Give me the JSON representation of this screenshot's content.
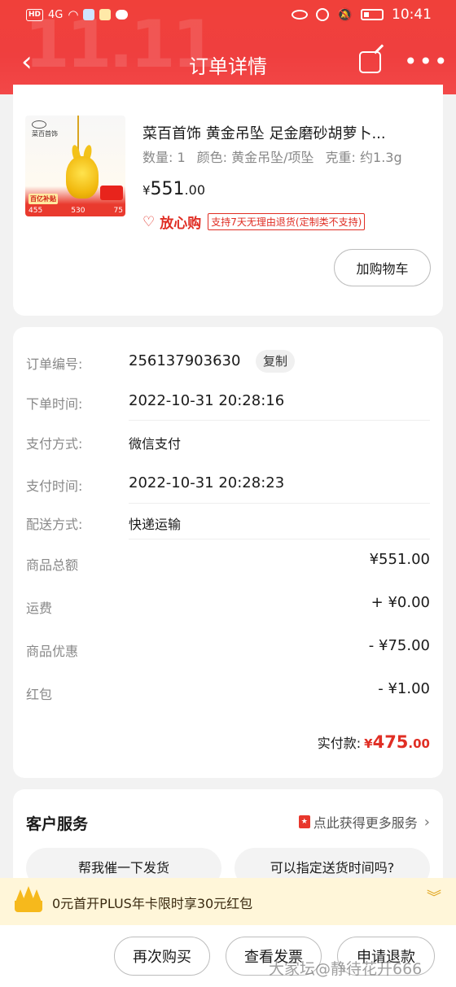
{
  "statusbar": {
    "hd": "HD",
    "signal": "4G",
    "time": "10:41"
  },
  "header": {
    "title": "订单详情",
    "bg_deco": "11.11"
  },
  "product": {
    "brand": "菜百首饰",
    "title": "菜百首饰 黄金吊坠 足金磨砂胡萝卜...",
    "quantity": "数量: 1",
    "color": "颜色: 黄金吊坠/项坠",
    "weight": "克重: 约1.3g",
    "price_sym": "¥",
    "price_int": "551",
    "price_dec": ".00",
    "assure_label": "放心购",
    "assure_policy": "支持7天无理由退货(定制类不支持)",
    "add_cart": "加购物车",
    "thumb_tag": "百亿补贴",
    "thumb_prices": [
      "455",
      "530",
      "75"
    ]
  },
  "order": {
    "rows": [
      {
        "label": "订单编号:",
        "value": "256137903630"
      },
      {
        "label": "下单时间:",
        "value": "2022-10-31 20:28:16"
      },
      {
        "label": "支付方式:",
        "value": "微信支付"
      },
      {
        "label": "支付时间:",
        "value": "2022-10-31 20:28:23"
      },
      {
        "label": "配送方式:",
        "value": "快递运输"
      }
    ],
    "copy_label": "复制",
    "amounts": [
      {
        "label": "商品总额",
        "value": "¥551.00"
      },
      {
        "label": "运费",
        "value": "+ ¥0.00"
      },
      {
        "label": "商品优惠",
        "value": "- ¥75.00"
      },
      {
        "label": "红包",
        "value": "- ¥1.00"
      }
    ],
    "paid_label": "实付款:",
    "paid_sym": "¥",
    "paid_int": "475",
    "paid_dec": ".00"
  },
  "service": {
    "title": "客户服务",
    "more": "点此获得更多服务",
    "chips": [
      "帮我催一下发货",
      "可以指定送货时间吗?"
    ]
  },
  "promo": {
    "text": "0元首开PLUS年卡限时享30元红包"
  },
  "bottom": {
    "buttons": [
      "再次购买",
      "查看发票",
      "申请退款"
    ]
  },
  "watermark": "大家坛@静待花开666",
  "colors": {
    "header": "#ef3f3f",
    "accent_red": "#e02e24",
    "promo_bg": "#fff6d9"
  }
}
